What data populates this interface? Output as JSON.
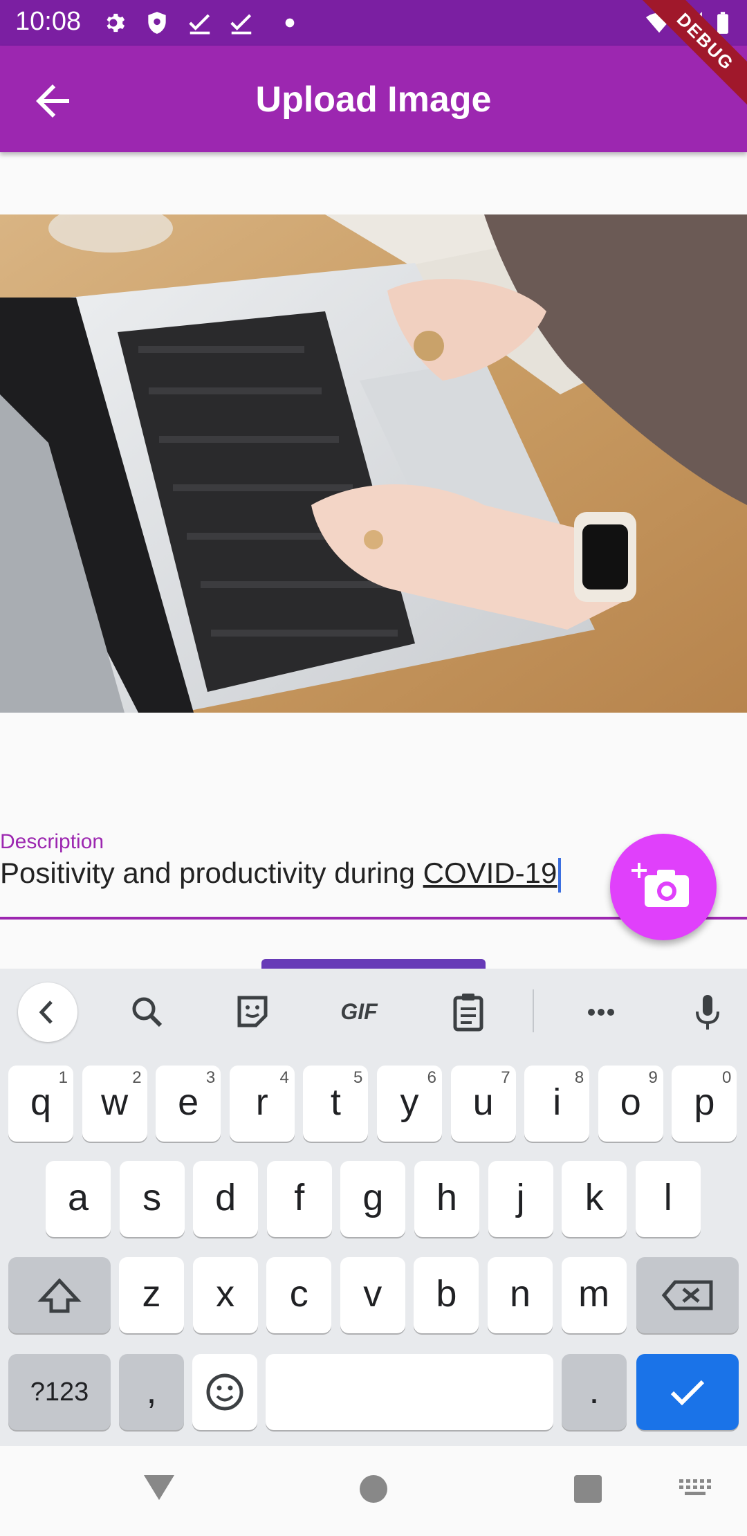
{
  "status_bar": {
    "time": "10:08",
    "icons": [
      "gear-icon",
      "shield-icon",
      "check-icon",
      "check-icon",
      "dot-icon",
      "wifi-icon",
      "signal-icon",
      "battery-icon"
    ]
  },
  "app_bar": {
    "title": "Upload Image",
    "back_icon": "arrow-back-icon",
    "debug_banner": "DEBUG",
    "color": "#9c27b0"
  },
  "photo": {
    "icon": "photo-laptop-typing"
  },
  "description": {
    "label": "Description",
    "value_plain": "Positivity and productivity during ",
    "value_underlined": "COVID-19",
    "accent": "#9c27b0"
  },
  "fab": {
    "icon": "add-a-photo-icon",
    "color": "#e040fb"
  },
  "keyboard": {
    "toolbar": [
      "chevron-left-icon",
      "search-icon",
      "sticker-icon",
      "gif-icon",
      "clipboard-icon",
      "more-horiz-icon",
      "mic-icon"
    ],
    "gif_label": "GIF",
    "row1": [
      {
        "k": "q",
        "h": "1"
      },
      {
        "k": "w",
        "h": "2"
      },
      {
        "k": "e",
        "h": "3"
      },
      {
        "k": "r",
        "h": "4"
      },
      {
        "k": "t",
        "h": "5"
      },
      {
        "k": "y",
        "h": "6"
      },
      {
        "k": "u",
        "h": "7"
      },
      {
        "k": "i",
        "h": "8"
      },
      {
        "k": "o",
        "h": "9"
      },
      {
        "k": "p",
        "h": "0"
      }
    ],
    "row2": [
      "a",
      "s",
      "d",
      "f",
      "g",
      "h",
      "j",
      "k",
      "l"
    ],
    "row3": [
      "z",
      "x",
      "c",
      "v",
      "b",
      "n",
      "m"
    ],
    "symbols_label": "?123",
    "comma": ",",
    "period": ".",
    "enter_color": "#1a73e8"
  },
  "nav_bar": {
    "icons": [
      "back-triangle-icon",
      "home-circle-icon",
      "recents-square-icon",
      "keyboard-switch-icon"
    ]
  }
}
